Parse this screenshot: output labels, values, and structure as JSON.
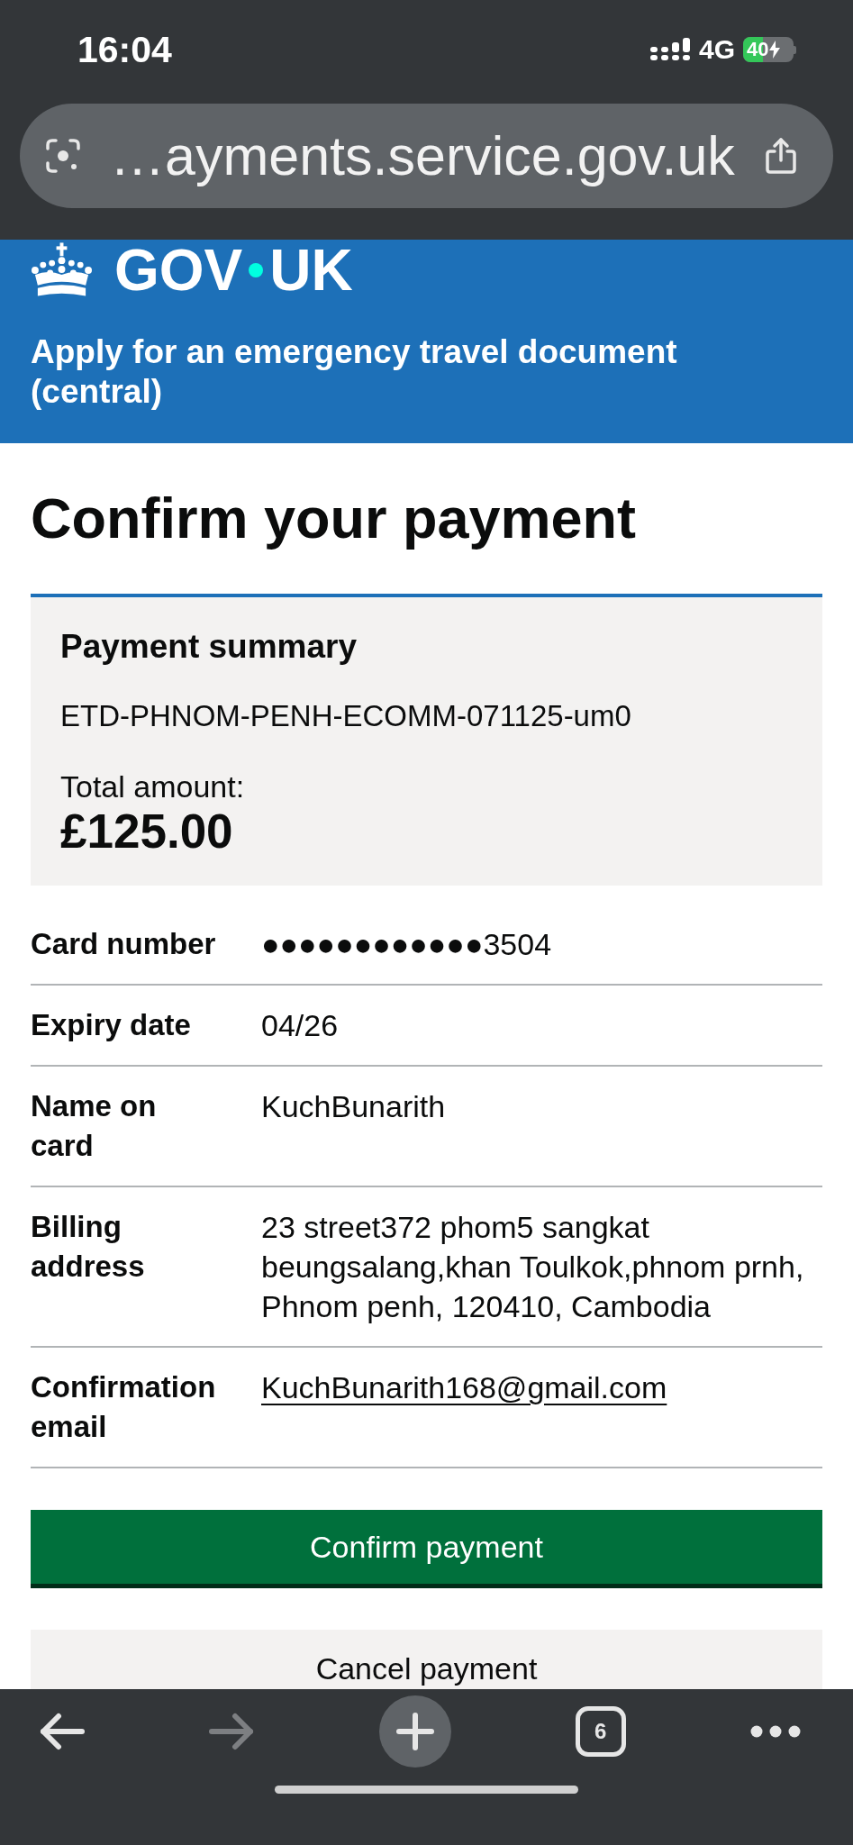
{
  "status_bar": {
    "time": "16:04",
    "network": "4G",
    "battery": {
      "text": "40",
      "charging": true
    }
  },
  "address_bar": {
    "url": "…ayments.service.gov.uk"
  },
  "header": {
    "logo": [
      "GOV",
      "UK"
    ],
    "service_name": "Apply for an emergency travel document (central)"
  },
  "page": {
    "heading": "Confirm your payment",
    "summary": {
      "title": "Payment summary",
      "reference": "ETD-PHNOM-PENH-ECOMM-071125-um0",
      "total_label": "Total amount:",
      "total": "£125.00"
    },
    "details": [
      {
        "kind": "text",
        "key": "Card number",
        "value": "●●●●●●●●●●●●3504"
      },
      {
        "kind": "text",
        "key": "Expiry date",
        "value": "04/26"
      },
      {
        "kind": "text",
        "key": "Name on card",
        "value": "KuchBunarith"
      },
      {
        "kind": "lines",
        "key": "Billing address",
        "value": [
          "23 street372 phom5 sangkat",
          "beungsalang,khan Toulkok,phnom prnh,",
          "Phnom penh, 120410, Cambodia"
        ]
      },
      {
        "kind": "link",
        "key": "Confirmation email",
        "value": "KuchBunarith168@gmail.com"
      }
    ],
    "buttons": [
      {
        "kind": "submit",
        "label": "Confirm payment"
      },
      {
        "kind": "cancel",
        "label": "Cancel payment"
      }
    ]
  },
  "toolbar": {
    "buttons": [
      {
        "kind": "back",
        "disabled": false
      },
      {
        "kind": "forward",
        "disabled": true
      },
      {
        "kind": "new_tab",
        "disabled": false
      },
      {
        "kind": "tabs",
        "label": "6",
        "disabled": false
      },
      {
        "kind": "more",
        "disabled": false
      }
    ]
  }
}
